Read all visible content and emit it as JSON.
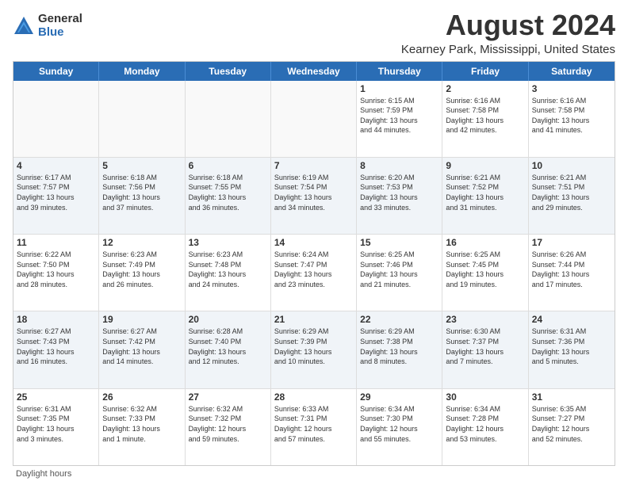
{
  "logo": {
    "general": "General",
    "blue": "Blue"
  },
  "title": "August 2024",
  "subtitle": "Kearney Park, Mississippi, United States",
  "days_of_week": [
    "Sunday",
    "Monday",
    "Tuesday",
    "Wednesday",
    "Thursday",
    "Friday",
    "Saturday"
  ],
  "footer": "Daylight hours",
  "weeks": [
    [
      {
        "day": "",
        "info": ""
      },
      {
        "day": "",
        "info": ""
      },
      {
        "day": "",
        "info": ""
      },
      {
        "day": "",
        "info": ""
      },
      {
        "day": "1",
        "info": "Sunrise: 6:15 AM\nSunset: 7:59 PM\nDaylight: 13 hours\nand 44 minutes."
      },
      {
        "day": "2",
        "info": "Sunrise: 6:16 AM\nSunset: 7:58 PM\nDaylight: 13 hours\nand 42 minutes."
      },
      {
        "day": "3",
        "info": "Sunrise: 6:16 AM\nSunset: 7:58 PM\nDaylight: 13 hours\nand 41 minutes."
      }
    ],
    [
      {
        "day": "4",
        "info": "Sunrise: 6:17 AM\nSunset: 7:57 PM\nDaylight: 13 hours\nand 39 minutes."
      },
      {
        "day": "5",
        "info": "Sunrise: 6:18 AM\nSunset: 7:56 PM\nDaylight: 13 hours\nand 37 minutes."
      },
      {
        "day": "6",
        "info": "Sunrise: 6:18 AM\nSunset: 7:55 PM\nDaylight: 13 hours\nand 36 minutes."
      },
      {
        "day": "7",
        "info": "Sunrise: 6:19 AM\nSunset: 7:54 PM\nDaylight: 13 hours\nand 34 minutes."
      },
      {
        "day": "8",
        "info": "Sunrise: 6:20 AM\nSunset: 7:53 PM\nDaylight: 13 hours\nand 33 minutes."
      },
      {
        "day": "9",
        "info": "Sunrise: 6:21 AM\nSunset: 7:52 PM\nDaylight: 13 hours\nand 31 minutes."
      },
      {
        "day": "10",
        "info": "Sunrise: 6:21 AM\nSunset: 7:51 PM\nDaylight: 13 hours\nand 29 minutes."
      }
    ],
    [
      {
        "day": "11",
        "info": "Sunrise: 6:22 AM\nSunset: 7:50 PM\nDaylight: 13 hours\nand 28 minutes."
      },
      {
        "day": "12",
        "info": "Sunrise: 6:23 AM\nSunset: 7:49 PM\nDaylight: 13 hours\nand 26 minutes."
      },
      {
        "day": "13",
        "info": "Sunrise: 6:23 AM\nSunset: 7:48 PM\nDaylight: 13 hours\nand 24 minutes."
      },
      {
        "day": "14",
        "info": "Sunrise: 6:24 AM\nSunset: 7:47 PM\nDaylight: 13 hours\nand 23 minutes."
      },
      {
        "day": "15",
        "info": "Sunrise: 6:25 AM\nSunset: 7:46 PM\nDaylight: 13 hours\nand 21 minutes."
      },
      {
        "day": "16",
        "info": "Sunrise: 6:25 AM\nSunset: 7:45 PM\nDaylight: 13 hours\nand 19 minutes."
      },
      {
        "day": "17",
        "info": "Sunrise: 6:26 AM\nSunset: 7:44 PM\nDaylight: 13 hours\nand 17 minutes."
      }
    ],
    [
      {
        "day": "18",
        "info": "Sunrise: 6:27 AM\nSunset: 7:43 PM\nDaylight: 13 hours\nand 16 minutes."
      },
      {
        "day": "19",
        "info": "Sunrise: 6:27 AM\nSunset: 7:42 PM\nDaylight: 13 hours\nand 14 minutes."
      },
      {
        "day": "20",
        "info": "Sunrise: 6:28 AM\nSunset: 7:40 PM\nDaylight: 13 hours\nand 12 minutes."
      },
      {
        "day": "21",
        "info": "Sunrise: 6:29 AM\nSunset: 7:39 PM\nDaylight: 13 hours\nand 10 minutes."
      },
      {
        "day": "22",
        "info": "Sunrise: 6:29 AM\nSunset: 7:38 PM\nDaylight: 13 hours\nand 8 minutes."
      },
      {
        "day": "23",
        "info": "Sunrise: 6:30 AM\nSunset: 7:37 PM\nDaylight: 13 hours\nand 7 minutes."
      },
      {
        "day": "24",
        "info": "Sunrise: 6:31 AM\nSunset: 7:36 PM\nDaylight: 13 hours\nand 5 minutes."
      }
    ],
    [
      {
        "day": "25",
        "info": "Sunrise: 6:31 AM\nSunset: 7:35 PM\nDaylight: 13 hours\nand 3 minutes."
      },
      {
        "day": "26",
        "info": "Sunrise: 6:32 AM\nSunset: 7:33 PM\nDaylight: 13 hours\nand 1 minute."
      },
      {
        "day": "27",
        "info": "Sunrise: 6:32 AM\nSunset: 7:32 PM\nDaylight: 12 hours\nand 59 minutes."
      },
      {
        "day": "28",
        "info": "Sunrise: 6:33 AM\nSunset: 7:31 PM\nDaylight: 12 hours\nand 57 minutes."
      },
      {
        "day": "29",
        "info": "Sunrise: 6:34 AM\nSunset: 7:30 PM\nDaylight: 12 hours\nand 55 minutes."
      },
      {
        "day": "30",
        "info": "Sunrise: 6:34 AM\nSunset: 7:28 PM\nDaylight: 12 hours\nand 53 minutes."
      },
      {
        "day": "31",
        "info": "Sunrise: 6:35 AM\nSunset: 7:27 PM\nDaylight: 12 hours\nand 52 minutes."
      }
    ]
  ]
}
